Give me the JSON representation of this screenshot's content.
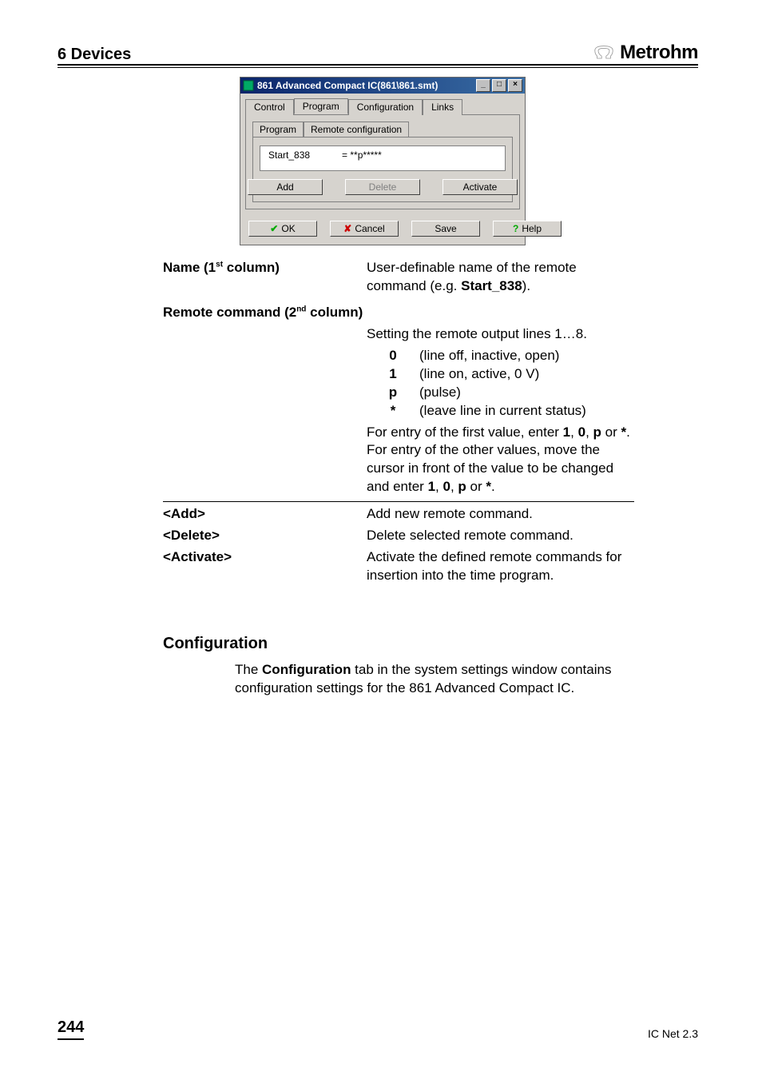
{
  "header": {
    "section": "6  Devices",
    "brand": "Metrohm"
  },
  "screenshot": {
    "title": "861 Advanced Compact IC(861\\861.smt)",
    "tabs": [
      "Control",
      "Program",
      "Configuration",
      "Links"
    ],
    "active_tab_index": 1,
    "inner_tabs": [
      "Program",
      "Remote configuration"
    ],
    "inner_active_index": 0,
    "list_col1": "Start_838",
    "list_col2": "= **p*****",
    "buttons": {
      "add": "Add",
      "delete": "Delete",
      "activate": "Activate"
    },
    "dialog_buttons": {
      "ok": "OK",
      "cancel": "Cancel",
      "save": "Save",
      "help": "Help"
    }
  },
  "definitions": {
    "name_term": "Name (1",
    "name_term_sup": "st",
    "name_term_tail": " column)",
    "name_body_1": "User-definable name of the remote command (e.g. ",
    "name_body_bold": "Start_838",
    "name_body_2": ").",
    "remote_term": "Remote command (2",
    "remote_term_sup": "nd",
    "remote_term_tail": " column)",
    "remote_intro": "Setting the remote output lines 1…8.",
    "codes": [
      {
        "sym": "0",
        "desc": "(line off, inactive, open)"
      },
      {
        "sym": "1",
        "desc": "(line on, active, 0 V)"
      },
      {
        "sym": "p",
        "desc": "(pulse)"
      },
      {
        "sym": "*",
        "desc": "(leave line in current status)"
      }
    ],
    "remote_entry_1a": "For entry of the first value, enter ",
    "remote_entry_b1": "1",
    "remote_sep": ", ",
    "remote_entry_b2": "0",
    "remote_entry_b3": "p",
    "remote_or": " or ",
    "remote_entry_b4": "*",
    "remote_period": ".",
    "remote_entry_2": "For entry of the other values, move the cursor in front of the value to be changed and enter ",
    "add_term": "<Add>",
    "add_body": "Add new remote command.",
    "delete_term": "<Delete>",
    "delete_body": "Delete selected remote command.",
    "activate_term": "<Activate>",
    "activate_body": "Activate the defined remote commands for insertion into the time program."
  },
  "configuration": {
    "heading": "Configuration",
    "body_1": "The ",
    "body_bold": "Configuration",
    "body_2": " tab in the system settings window contains configuration settings for the 861 Advanced Compact IC."
  },
  "footer": {
    "page": "244",
    "product": "IC Net 2.3"
  }
}
